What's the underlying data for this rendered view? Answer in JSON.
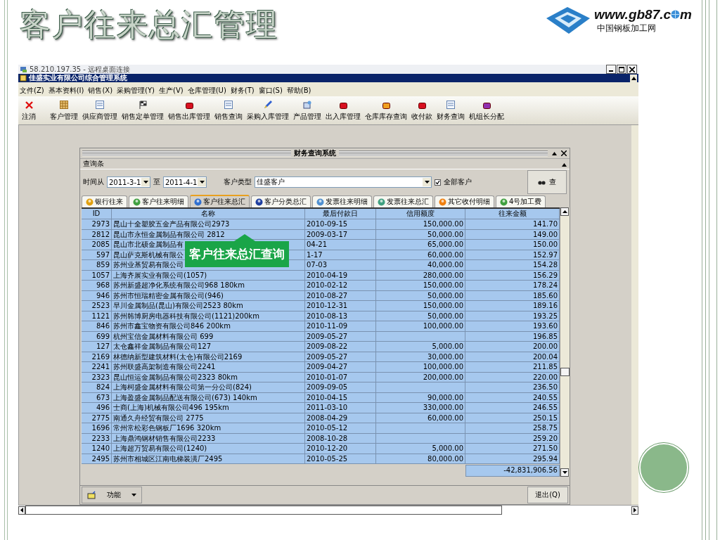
{
  "slide": {
    "title": "客户往来总汇管理",
    "logo_text": "www.gb87.c",
    "logo_tail": "m",
    "logo_subtitle": "中国钢板加工网"
  },
  "window": {
    "title": "58.210.197.35 - 远程桌面连接",
    "app_title": "佳盛实业有限公司综合管理系统",
    "menu": [
      "文件(Z)",
      "基本资料(I)",
      "销售(X)",
      "采购管理(Y)",
      "生产(V)",
      "仓库管理(U)",
      "财务(T)",
      "窗口(S)",
      "帮助(B)"
    ],
    "toolbar": [
      {
        "label": "注消",
        "kind": "cross"
      },
      {
        "label": "客户管理",
        "kind": "ledger"
      },
      {
        "label": "供应商管理",
        "kind": "sheet"
      },
      {
        "label": "销售定单管理",
        "kind": "flag"
      },
      {
        "label": "销售出库管理",
        "kind": "red"
      },
      {
        "label": "销售查询",
        "kind": "note"
      },
      {
        "label": "采购入库管理",
        "kind": "pen"
      },
      {
        "label": "产品管理",
        "kind": "box"
      },
      {
        "label": "出入库管理",
        "kind": "red"
      },
      {
        "label": "仓库库存查询",
        "kind": "orange"
      },
      {
        "label": "收付款",
        "kind": "red"
      },
      {
        "label": "财务查询",
        "kind": "note"
      },
      {
        "label": "机组长分配",
        "kind": "purple"
      }
    ]
  },
  "dialog": {
    "title": "财务查询系统",
    "section": "查询条",
    "from_label": "时间从",
    "from": "2011-3-1",
    "to_label": "至",
    "to": "2011-4-1",
    "type_label": "客户类型",
    "type": "佳盛客户",
    "all_customers": {
      "label": "全部客户",
      "checked": true
    },
    "search_button": "查",
    "tabs": [
      {
        "label": "银行往来",
        "kind": "coins",
        "selected": false
      },
      {
        "label": "客户往来明细",
        "kind": "person",
        "selected": false
      },
      {
        "label": "客户往来总汇",
        "kind": "globe",
        "selected": true
      },
      {
        "label": "客户分类总汇",
        "kind": "window",
        "selected": false
      },
      {
        "label": "发票往来明细",
        "kind": "sheet",
        "selected": false
      },
      {
        "label": "发票往来总汇",
        "kind": "chart",
        "selected": false
      },
      {
        "label": "其它收付明细",
        "kind": "arrow",
        "selected": false
      },
      {
        "label": "4号加工费",
        "kind": "person",
        "selected": false
      }
    ],
    "table": {
      "columns": [
        "ID",
        "名称",
        "最后付款日",
        "信用额度",
        "往来金额"
      ],
      "rows": [
        {
          "id": "2973",
          "name": "昆山十全塑胶五金产品有限公司2973",
          "date": "2010-09-15",
          "credit": "150,000.00",
          "amount": "141.70"
        },
        {
          "id": "2812",
          "name": "昆山市永恒金属制品有限公司 2812",
          "date": "2009-03-17",
          "credit": "50,000.00",
          "amount": "149.00"
        },
        {
          "id": "2085",
          "name": "昆山市北硕金属制品有",
          "date": "04-21",
          "credit": "65,000.00",
          "amount": "150.00"
        },
        {
          "id": "597",
          "name": "昆山萨克斯机械有限公",
          "date": "1-17",
          "credit": "60,000.00",
          "amount": "152.97"
        },
        {
          "id": "859",
          "name": "苏州业基贸易有限公司",
          "date": "07-03",
          "credit": "40,000.00",
          "amount": "154.28"
        },
        {
          "id": "1057",
          "name": "上海齐展实业有限公司(1057)",
          "date": "2010-04-19",
          "credit": "280,000.00",
          "amount": "156.29"
        },
        {
          "id": "968",
          "name": "苏州新盛超净化系统有限公司968  180km",
          "date": "2010-02-12",
          "credit": "150,000.00",
          "amount": "178.24"
        },
        {
          "id": "946",
          "name": "苏州市恒瑞精密金属有限公司(946)",
          "date": "2010-08-27",
          "credit": "50,000.00",
          "amount": "185.60"
        },
        {
          "id": "2523",
          "name": "早川金属制品(昆山)有限公司2523  80km",
          "date": "2010-12-31",
          "credit": "150,000.00",
          "amount": "189.16"
        },
        {
          "id": "1121",
          "name": "苏州韩博厨房电器科技有限公司(1121)200km",
          "date": "2010-08-13",
          "credit": "50,000.00",
          "amount": "193.25"
        },
        {
          "id": "846",
          "name": "苏州市鑫宝物资有限公司846  200km",
          "date": "2010-11-09",
          "credit": "100,000.00",
          "amount": "193.60"
        },
        {
          "id": "699",
          "name": "杭州宝信金属材料有限公司    699",
          "date": "2009-05-27",
          "amount": "196.85"
        },
        {
          "id": "127",
          "name": "太仓鑫祥金属制品有限公司127",
          "date": "2009-08-22",
          "credit": "5,000.00",
          "amount": "200.00"
        },
        {
          "id": "2169",
          "name": "林德纳新型建筑材料(太仓)有限公司2169",
          "date": "2009-05-27",
          "credit": "30,000.00",
          "amount": "200.04"
        },
        {
          "id": "2241",
          "name": "苏州联盛高架制造有限公司2241",
          "date": "2009-04-27",
          "credit": "100,000.00",
          "amount": "211.85"
        },
        {
          "id": "2323",
          "name": "昆山恒运金属制品有限公司2323  80km",
          "date": "2010-01-07",
          "credit": "200,000.00",
          "amount": "220.00"
        },
        {
          "id": "824",
          "name": "上海柯盛金属材料有限公司第一分公司(824)",
          "date": "2009-09-05",
          "amount": "236.50"
        },
        {
          "id": "673",
          "name": "上海盈盛金属制品配送有限公司(673) 140km",
          "date": "2010-04-15",
          "credit": "90,000.00",
          "amount": "240.55"
        },
        {
          "id": "496",
          "name": "士商(上海)机械有限公司496  195km",
          "date": "2011-03-10",
          "credit": "330,000.00",
          "amount": "246.55"
        },
        {
          "id": "2775",
          "name": "南通久舟经贸有限公司    2775",
          "date": "2008-04-29",
          "credit": "60,000.00",
          "amount": "250.15"
        },
        {
          "id": "1696",
          "name": "常州常松彩色钢板厂1696  320km",
          "date": "2010-05-12",
          "amount": "258.75"
        },
        {
          "id": "2233",
          "name": "上海鼎鸿钢材销售有限公司2233",
          "date": "2008-10-28",
          "amount": "259.20"
        },
        {
          "id": "1240",
          "name": "上海超万贸易有限公司(1240)",
          "date": "2010-12-20",
          "credit": "5,000.00",
          "amount": "271.50"
        },
        {
          "id": "2495",
          "name": "苏州市相城区江南电梯装潢厂2495",
          "date": "2010-05-25",
          "credit": "80,000.00",
          "amount": "295.94"
        }
      ],
      "total": "-42,831,906.56"
    },
    "function_button": "功能",
    "exit_button": "退出(Q)"
  },
  "callout": "客户往来总汇查询"
}
